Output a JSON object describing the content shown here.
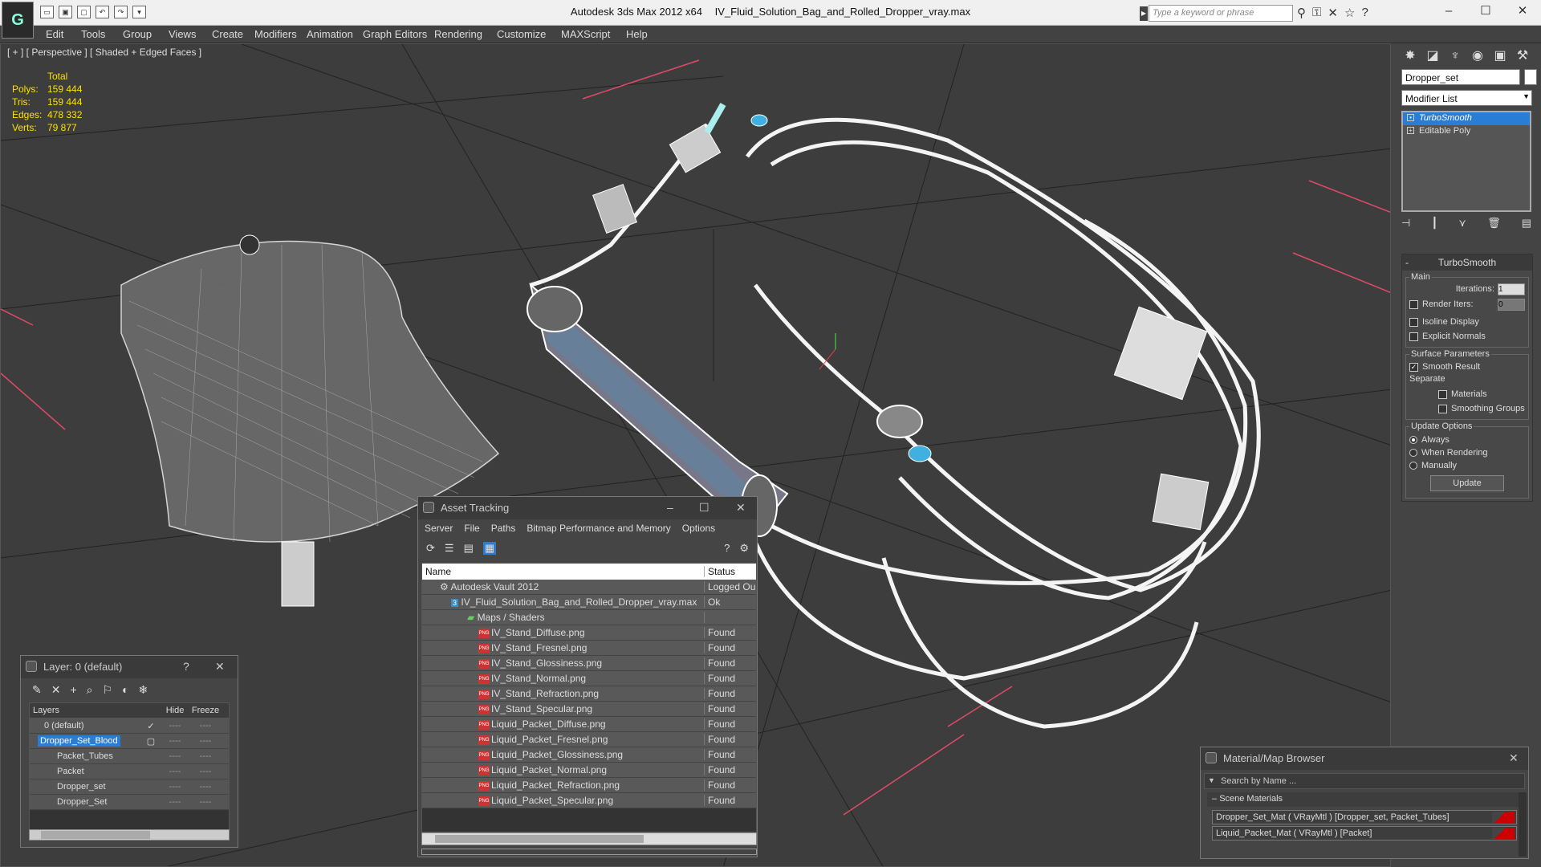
{
  "app": {
    "title": "Autodesk 3ds Max  2012 x64",
    "file": "IV_Fluid_Solution_Bag_and_Rolled_Dropper_vray.max",
    "search_placeholder": "Type a keyword or phrase",
    "logo_glyph": "G"
  },
  "menu": [
    "Edit",
    "Tools",
    "Group",
    "Views",
    "Create",
    "Modifiers",
    "Animation",
    "Graph Editors",
    "Rendering",
    "Customize",
    "MAXScript",
    "Help"
  ],
  "viewport": {
    "label": "[ + ] [ Perspective ] [ Shaded + Edged Faces ]",
    "stats": {
      "header": "Total",
      "rows": [
        {
          "k": "Polys:",
          "v": "159 444"
        },
        {
          "k": "Tris:",
          "v": "159 444"
        },
        {
          "k": "Edges:",
          "v": "478 332"
        },
        {
          "k": "Verts:",
          "v": "79 877"
        }
      ]
    }
  },
  "cmd": {
    "object_name": "Dropper_set",
    "modifier_list": "Modifier List",
    "stack": [
      "TurboSmooth",
      "Editable Poly"
    ],
    "rollout_title": "TurboSmooth",
    "main_label": "Main",
    "iterations_label": "Iterations:",
    "iterations_value": "1",
    "render_iters_label": "Render Iters:",
    "render_iters_value": "0",
    "isoline": "Isoline Display",
    "explicit": "Explicit Normals",
    "surface_label": "Surface Parameters",
    "smooth_result": "Smooth Result",
    "separate_label": "Separate",
    "materials": "Materials",
    "smoothing_groups": "Smoothing Groups",
    "update_label": "Update Options",
    "always": "Always",
    "when_rendering": "When Rendering",
    "manually": "Manually",
    "update_btn": "Update"
  },
  "layers_dialog": {
    "title": "Layer: 0 (default)",
    "help": "?",
    "columns": {
      "layers": "Layers",
      "hide": "Hide",
      "freeze": "Freeze"
    },
    "rows": [
      {
        "name": "0 (default)",
        "check": "✓"
      },
      {
        "name": "Dropper_Set_Blood",
        "check": "▢",
        "selected": true
      },
      {
        "name": "Packet_Tubes"
      },
      {
        "name": "Packet"
      },
      {
        "name": "Dropper_set"
      },
      {
        "name": "Dropper_Set"
      }
    ],
    "dash": "----"
  },
  "asset_dialog": {
    "title": "Asset Tracking",
    "menu": [
      "Server",
      "File",
      "Paths",
      "Bitmap Performance and Memory",
      "Options"
    ],
    "columns": {
      "name": "Name",
      "status": "Status"
    },
    "rows": [
      {
        "name": "Autodesk Vault 2012",
        "status": "Logged Ou",
        "indent": 1
      },
      {
        "name": "IV_Fluid_Solution_Bag_and_Rolled_Dropper_vray.max",
        "status": "Ok",
        "indent": 2
      },
      {
        "name": "Maps / Shaders",
        "status": "",
        "indent": 3
      },
      {
        "name": "IV_Stand_Diffuse.png",
        "status": "Found",
        "indent": 4
      },
      {
        "name": "IV_Stand_Fresnel.png",
        "status": "Found",
        "indent": 4
      },
      {
        "name": "IV_Stand_Glossiness.png",
        "status": "Found",
        "indent": 4
      },
      {
        "name": "IV_Stand_Normal.png",
        "status": "Found",
        "indent": 4
      },
      {
        "name": "IV_Stand_Refraction.png",
        "status": "Found",
        "indent": 4
      },
      {
        "name": "IV_Stand_Specular.png",
        "status": "Found",
        "indent": 4
      },
      {
        "name": "Liquid_Packet_Diffuse.png",
        "status": "Found",
        "indent": 4
      },
      {
        "name": "Liquid_Packet_Fresnel.png",
        "status": "Found",
        "indent": 4
      },
      {
        "name": "Liquid_Packet_Glossiness.png",
        "status": "Found",
        "indent": 4
      },
      {
        "name": "Liquid_Packet_Normal.png",
        "status": "Found",
        "indent": 4
      },
      {
        "name": "Liquid_Packet_Refraction.png",
        "status": "Found",
        "indent": 4
      },
      {
        "name": "Liquid_Packet_Specular.png",
        "status": "Found",
        "indent": 4
      }
    ]
  },
  "mat_dialog": {
    "title": "Material/Map Browser",
    "search": "Search by Name ...",
    "section": "Scene Materials",
    "items": [
      "Dropper_Set_Mat  ( VRayMtl ) [Dropper_set, Packet_Tubes]",
      "Liquid_Packet_Mat  ( VRayMtl ) [Packet]"
    ]
  },
  "colors": {
    "selection": "#2a7dd4",
    "stats": "#ffe000",
    "wire": "#ffffff",
    "accent": "#3fb0e0"
  }
}
